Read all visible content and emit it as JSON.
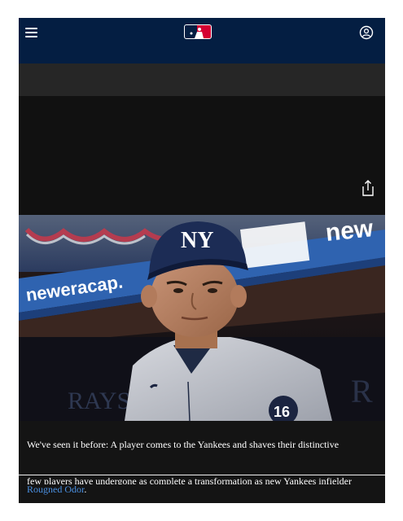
{
  "header": {
    "menu_icon": "hamburger-menu-icon",
    "logo": "mlb-logo",
    "account_icon": "user-account-icon",
    "colors": {
      "navy": "#041e42",
      "red": "#d50032"
    }
  },
  "media": {
    "share_icon": "share-icon",
    "hero_alt": "Yankees player in navy NY cap and gray road jersey with number 16, in front of a neweracap.com stadium banner"
  },
  "article": {
    "caption": "We've seen it before: A player comes to the Yankees and shaves their distinctive",
    "cut_line": "few players have undergone as complete a transformation as new Yankees infielder",
    "link_text": "Rougned Odor",
    "after_link": ".",
    "link_color": "#4a90e2"
  }
}
